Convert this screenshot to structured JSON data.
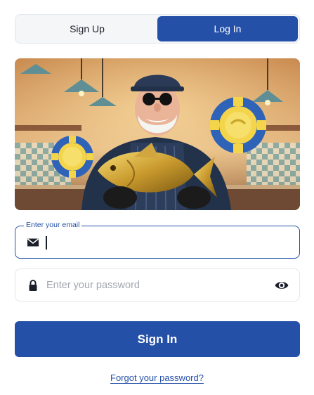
{
  "tabs": [
    {
      "label": "Sign Up",
      "active": false
    },
    {
      "label": "Log In",
      "active": true
    }
  ],
  "hero": {
    "alt": "Smiling man in sunglasses and cap holding a golden fish with blue and yellow casino chips"
  },
  "email": {
    "legend": "Enter your email",
    "value": "",
    "placeholder": "",
    "icon": "envelope-icon"
  },
  "password": {
    "placeholder": "Enter your password",
    "value": "",
    "icon": "lock-icon",
    "toggle_icon": "eye-icon"
  },
  "submit": {
    "label": "Sign In"
  },
  "forgot": {
    "label": "Forgot your password?"
  },
  "colors": {
    "accent": "#2550a8",
    "border": "#e3e6ec",
    "tab_bg": "#f5f6f8"
  }
}
